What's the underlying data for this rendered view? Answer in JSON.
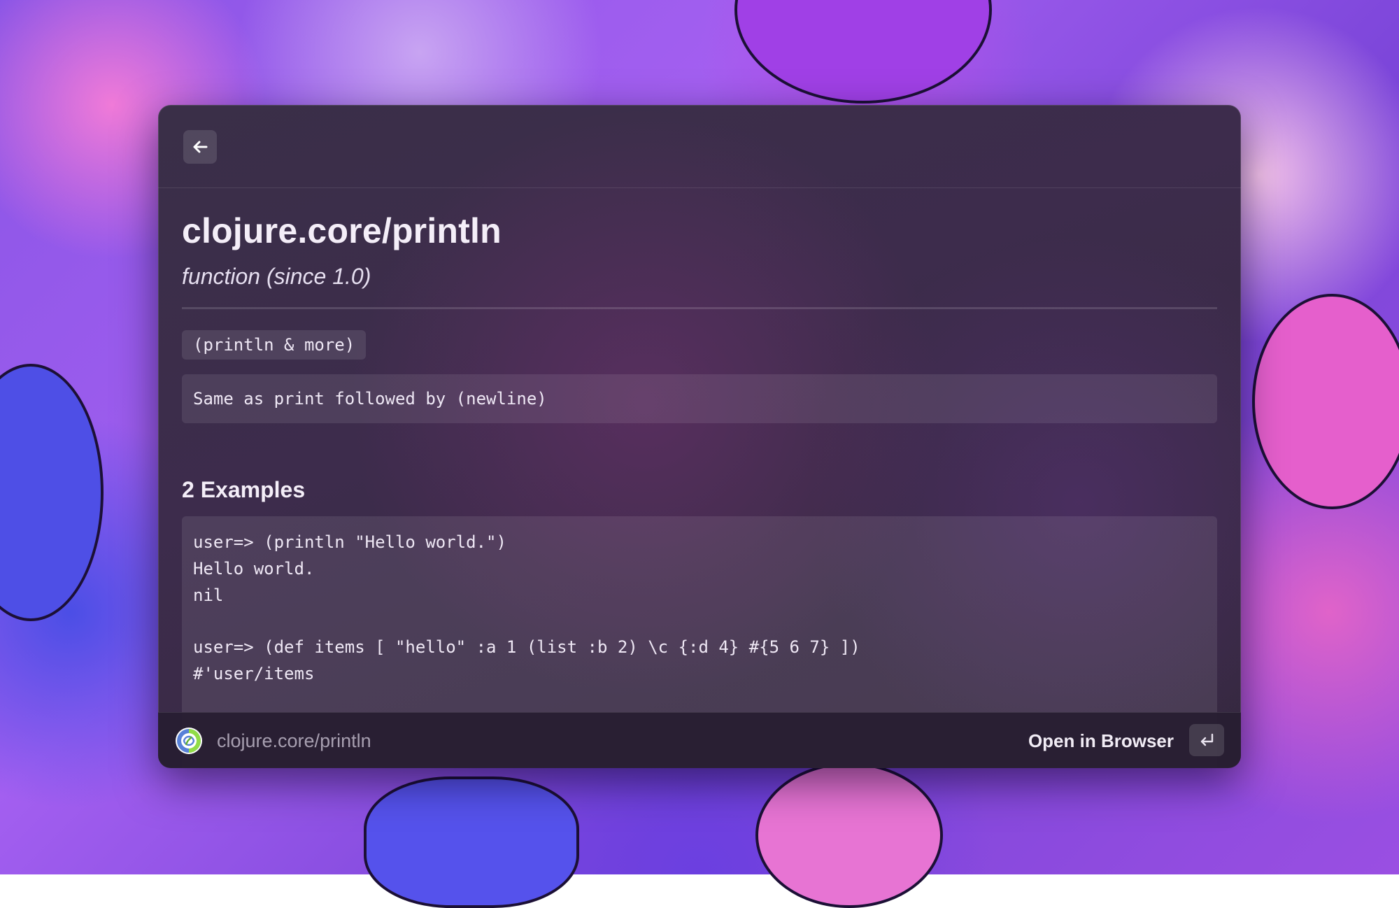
{
  "window": {
    "back_icon": "arrow-left-icon"
  },
  "doc": {
    "title": "clojure.core/println",
    "subtitle": "function (since 1.0)",
    "signature": "(println & more)",
    "docstring": "Same as print followed by (newline)"
  },
  "examples": {
    "heading": "2 Examples",
    "lines": [
      "user=> (println \"Hello world.\")",
      "Hello world.",
      "nil",
      "",
      "user=> (def items [ \"hello\" :a 1 (list :b 2) \\c {:d 4} #{5 6 7} ])",
      "#'user/items"
    ]
  },
  "footer": {
    "logo_icon": "clojure-logo-icon",
    "path": "clojure.core/println",
    "action_label": "Open in Browser",
    "enter_icon": "enter-key-icon"
  },
  "colors": {
    "window_bg": "#3a2f48",
    "text": "#f4eef8",
    "muted_text": "#a79fb0",
    "wallpaper_primary": "#8a55e6"
  }
}
